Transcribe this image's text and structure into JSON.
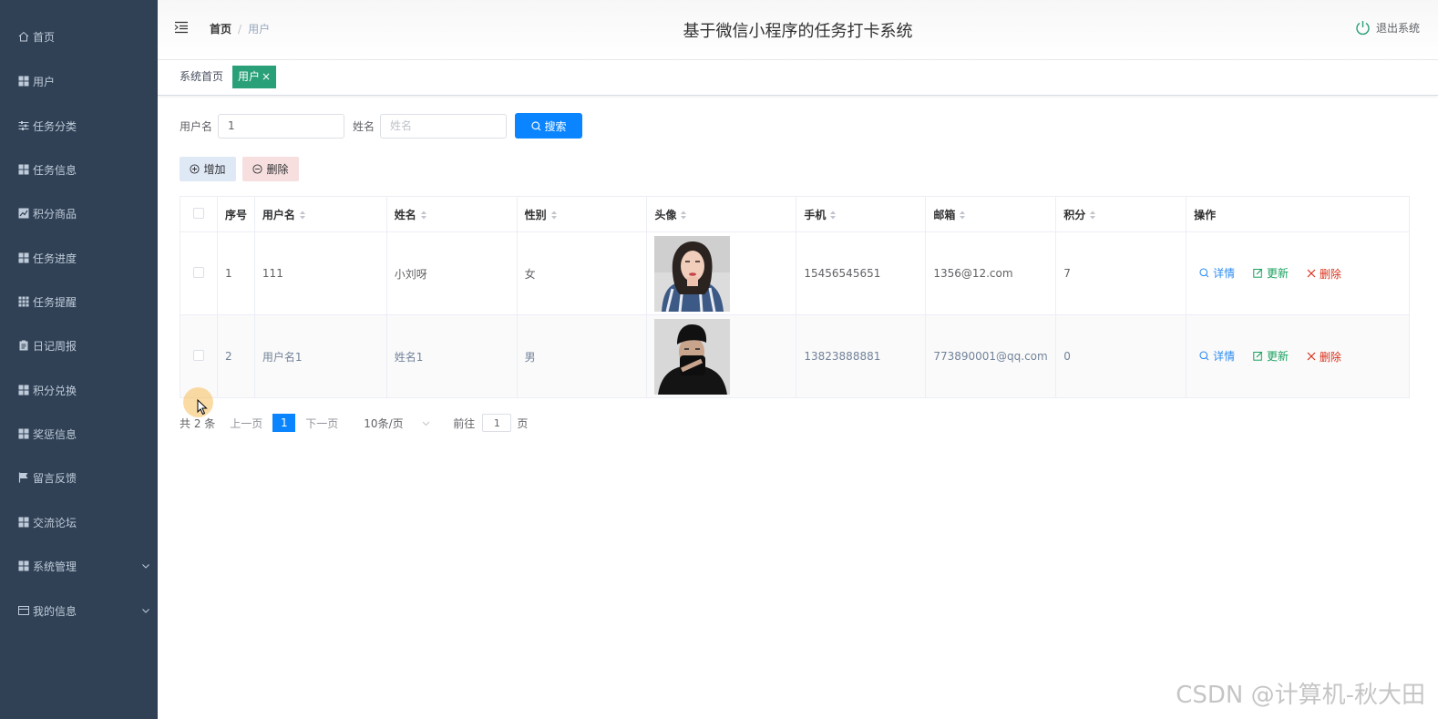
{
  "app": {
    "title": "基于微信小程序的任务打卡系统",
    "logout_label": "退出系统"
  },
  "colors": {
    "sidebar_bg": "#304156",
    "primary": "#0a84ff",
    "active_tag": "#2aa078",
    "update": "#19a15f",
    "danger": "#d9301a"
  },
  "sidebar": {
    "items": [
      {
        "label": "首页",
        "icon": "home-icon"
      },
      {
        "label": "用户",
        "icon": "grid-icon"
      },
      {
        "label": "任务分类",
        "icon": "sliders-icon"
      },
      {
        "label": "任务信息",
        "icon": "grid-icon"
      },
      {
        "label": "积分商品",
        "icon": "chart-icon"
      },
      {
        "label": "任务进度",
        "icon": "grid-icon"
      },
      {
        "label": "任务提醒",
        "icon": "apps-icon"
      },
      {
        "label": "日记周报",
        "icon": "clipboard-icon"
      },
      {
        "label": "积分兑换",
        "icon": "grid-icon"
      },
      {
        "label": "奖惩信息",
        "icon": "grid-icon"
      },
      {
        "label": "留言反馈",
        "icon": "flag-icon"
      },
      {
        "label": "交流论坛",
        "icon": "grid-icon"
      },
      {
        "label": "系统管理",
        "icon": "grid-icon"
      },
      {
        "label": "我的信息",
        "icon": "card-icon"
      }
    ]
  },
  "breadcrumb": {
    "home": "首页",
    "separator": "/",
    "current": "用户"
  },
  "tags": {
    "home": "系统首页",
    "active": "用户",
    "close": "×"
  },
  "search": {
    "username_label": "用户名",
    "username_value": "1",
    "name_label": "姓名",
    "name_placeholder": "姓名",
    "button": "搜索"
  },
  "actions": {
    "add": "增加",
    "delete": "删除"
  },
  "table": {
    "headers": [
      "序号",
      "用户名",
      "姓名",
      "性别",
      "头像",
      "手机",
      "邮箱",
      "积分",
      "操作"
    ],
    "rows": [
      {
        "index": "1",
        "username": "111",
        "name": "小刘呀",
        "gender": "女",
        "avatar": "avatar-woman",
        "phone": "15456545651",
        "email": "1356@12.com",
        "points": "7"
      },
      {
        "index": "2",
        "username": "用户名1",
        "name": "姓名1",
        "gender": "男",
        "avatar": "avatar-man",
        "phone": "13823888881",
        "email": "773890001@qq.com",
        "points": "0"
      }
    ],
    "ops": {
      "detail": "详情",
      "update": "更新",
      "remove": "删除"
    }
  },
  "pagination": {
    "total": "共 2 条",
    "prev": "上一页",
    "current": "1",
    "next": "下一页",
    "page_size": "10条/页",
    "goto_label": "前往",
    "goto_value": "1",
    "page_suffix": "页"
  },
  "watermark": "CSDN @计算机-秋大田"
}
